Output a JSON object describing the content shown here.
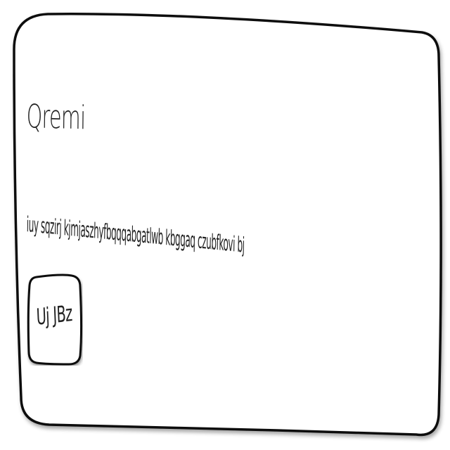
{
  "card": {
    "title": "Qremi",
    "body": "iuy sqzirj kjmjaszhyfbqqqabgatlwb kbggaq czubfkovi bj",
    "button_label": "Uj JBz"
  },
  "colors": {
    "stroke": "#111111",
    "background": "#ffffff",
    "text": "#222222"
  }
}
